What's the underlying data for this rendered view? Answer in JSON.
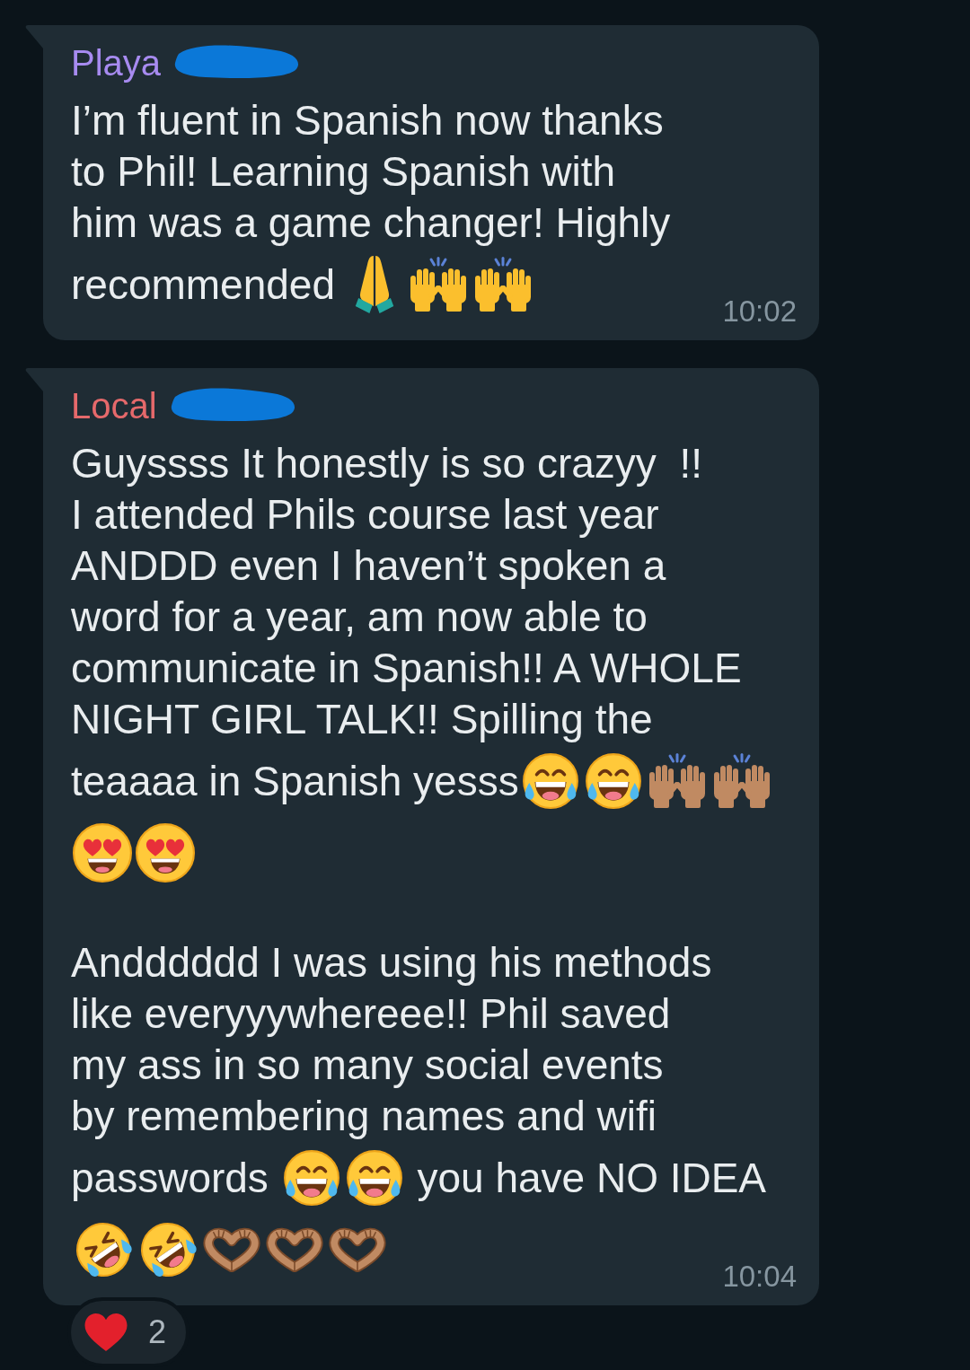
{
  "messages": [
    {
      "sender": {
        "name": "Playa",
        "color": "#a78bf0",
        "redacted": true
      },
      "paragraphs": [
        {
          "lines": [
            [
              {
                "kind": "text",
                "text": "I’m fluent in Spanish now thanks"
              }
            ],
            [
              {
                "kind": "text",
                "text": "to Phil! Learning Spanish with"
              }
            ],
            [
              {
                "kind": "text",
                "text": "him was a game changer! Highly"
              }
            ],
            [
              {
                "kind": "text",
                "text": "recommended "
              },
              {
                "kind": "pray",
                "color": "#fbbf2d"
              },
              {
                "kind": "praise",
                "color": "#fbbf2d"
              },
              {
                "kind": "praise",
                "color": "#fbbf2d"
              }
            ]
          ]
        }
      ],
      "time": "10:02"
    },
    {
      "sender": {
        "name": "Local",
        "color": "#e5696b",
        "redacted": true
      },
      "paragraphs": [
        {
          "lines": [
            [
              {
                "kind": "text",
                "text": "Guyssss It honestly is so crazyy  !!"
              }
            ],
            [
              {
                "kind": "text",
                "text": "I attended Phils course last year"
              }
            ],
            [
              {
                "kind": "text",
                "text": "ANDDD even I haven’t spoken a"
              }
            ],
            [
              {
                "kind": "text",
                "text": "word for a year, am now able to"
              }
            ],
            [
              {
                "kind": "text",
                "text": "communicate in Spanish!! A WHOLE"
              }
            ],
            [
              {
                "kind": "text",
                "text": "NIGHT GIRL TALK!! Spilling the"
              }
            ],
            [
              {
                "kind": "text",
                "text": "teaaaa in Spanish yesss"
              },
              {
                "kind": "joy"
              },
              {
                "kind": "joy"
              },
              {
                "kind": "praise",
                "color": "#c08a62"
              },
              {
                "kind": "praise",
                "color": "#c08a62"
              }
            ],
            [
              {
                "kind": "hearteyes"
              },
              {
                "kind": "hearteyes"
              }
            ]
          ]
        },
        {
          "lines": [
            [
              {
                "kind": "text",
                "text": "Andddddd I was using his methods"
              }
            ],
            [
              {
                "kind": "text",
                "text": "like everyyywhereee!! Phil saved"
              }
            ],
            [
              {
                "kind": "text",
                "text": "my ass in so many social events"
              }
            ],
            [
              {
                "kind": "text",
                "text": "by remembering names and wifi"
              }
            ],
            [
              {
                "kind": "text",
                "text": "passwords "
              },
              {
                "kind": "joy"
              },
              {
                "kind": "joy"
              },
              {
                "kind": "text",
                "text": " you have NO IDEA"
              }
            ],
            [
              {
                "kind": "rofl"
              },
              {
                "kind": "rofl"
              },
              {
                "kind": "hearthands",
                "color": "#c08a62"
              },
              {
                "kind": "hearthands",
                "color": "#c08a62"
              },
              {
                "kind": "hearthands",
                "color": "#c08a62"
              }
            ]
          ]
        }
      ],
      "time": "10:04",
      "reactions": [
        {
          "kind": "heart",
          "count": "2"
        }
      ]
    }
  ]
}
